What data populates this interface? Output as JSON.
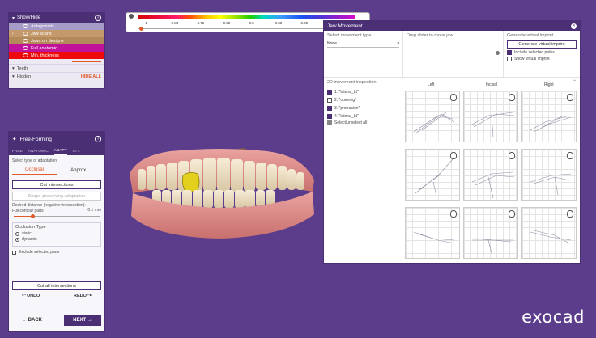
{
  "showhide": {
    "title": "Show/Hide",
    "layers": [
      {
        "label": "Antagonists",
        "color": "#a69cc8"
      },
      {
        "label": "Jaw scans",
        "color": "#c49a6c"
      },
      {
        "label": "Jaws on designs",
        "color": "#b58a5a"
      },
      {
        "label": "Full anatomic",
        "color": "#c0129a"
      },
      {
        "label": "Min. thickness",
        "color": "#ee0a0a"
      }
    ],
    "teeth_label": "Teeth",
    "hidden_label": "Hidden",
    "hide_all_label": "HIDE ALL"
  },
  "freeforming": {
    "title": "Free-Forming",
    "tabs": [
      "FREE",
      "ANATOMIC",
      "ADAPT",
      "ATT."
    ],
    "active_tab": "ADAPT",
    "adapt_type_label": "Select type of adaptation:",
    "seg_occlusal": "Occlusal",
    "seg_approx": "Approx.",
    "cut_intersections": "Cut intersections",
    "shape_preserving": "Shape-preserving adaptation",
    "desired_distance": "Desired distance (negative=intersection):",
    "full_contour_label": "Full contour parts",
    "full_contour_value": "0.1 mm",
    "distance_fraction": 0.22,
    "occlusion_type_label": "Occlusion Type",
    "occ_static": "static",
    "occ_dynamic": "dynamic",
    "exclude_label": "Exclude selected parts",
    "cut_all": "Cut all intersections",
    "undo": "UNDO",
    "redo": "REDO",
    "back": "BACK",
    "next": "NEXT"
  },
  "scale": {
    "ticks": [
      "-1",
      "-0.88",
      "-0.75",
      "-0.62",
      "-0.5",
      "-0.38",
      "-0.25"
    ]
  },
  "jaw": {
    "title": "Jaw Movement",
    "movement_type_label": "Select movement type",
    "movement_type_value": "None",
    "drag_label": "Drag slider to move jaw",
    "slider_fraction": 1.0,
    "gen_label": "Generate virtual imprint",
    "gen_button": "Generate virtual imprint",
    "include_paths": "Include selected paths",
    "show_imprint": "Show virtual imprint",
    "inspection_label": "2D movement inspection",
    "movements": [
      {
        "label": "1. \"lateral_Lt\"",
        "checked": true
      },
      {
        "label": "2. \"opening\"",
        "checked": false
      },
      {
        "label": "3. \"protrusion\"",
        "checked": true
      },
      {
        "label": "4. \"lateral_Lt\"",
        "checked": true
      }
    ],
    "select_all": "Select/unselect all",
    "col_headers": [
      "Left",
      "Incisal",
      "Right"
    ]
  },
  "brand": "exocad",
  "colors": {
    "background": "#5b3d8c",
    "header": "#4a2f75",
    "accent": "#e05a2a"
  }
}
